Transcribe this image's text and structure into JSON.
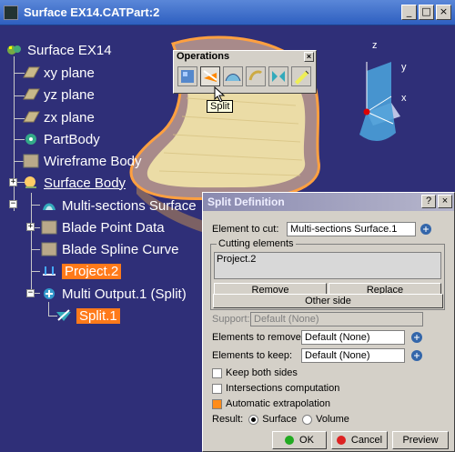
{
  "window": {
    "title": "Surface EX14.CATPart:2",
    "min": "_",
    "max": "□",
    "close": "×"
  },
  "tree": {
    "root": "Surface EX14",
    "items": [
      {
        "label": "xy plane"
      },
      {
        "label": "yz plane"
      },
      {
        "label": "zx plane"
      },
      {
        "label": "PartBody"
      },
      {
        "label": "Wireframe Body"
      },
      {
        "label": "Surface Body"
      },
      {
        "label": "Multi-sections Surface"
      },
      {
        "label": "Blade Point Data"
      },
      {
        "label": "Blade Spline Curve"
      },
      {
        "label": "Project.2"
      },
      {
        "label": "Multi Output.1 (Split)"
      },
      {
        "label": "Split.1"
      }
    ]
  },
  "operations": {
    "title": "Operations",
    "close": "×",
    "tooltip": "Split"
  },
  "compass": {
    "x": "x",
    "y": "y",
    "z": "z"
  },
  "dialog": {
    "title": "Split Definition",
    "help": "?",
    "close": "×",
    "element_to_cut_label": "Element to cut:",
    "element_to_cut_value": "Multi-sections Surface.1",
    "cutting_elements_label": "Cutting elements",
    "cutting_list": [
      "Project.2"
    ],
    "remove": "Remove",
    "replace": "Replace",
    "other_side": "Other side",
    "support_label": "Support:",
    "support_value": "Default (None)",
    "remove_label": "Elements to remove:",
    "remove_value": "Default (None)",
    "keep_label": "Elements to keep:",
    "keep_value": "Default (None)",
    "keep_both": "Keep both sides",
    "intersections": "Intersections computation",
    "auto_extrap": "Automatic extrapolation",
    "result_label": "Result:",
    "result_surface": "Surface",
    "result_volume": "Volume",
    "ok": "OK",
    "cancel": "Cancel",
    "preview": "Preview"
  },
  "colors": {
    "selection": "#ff7a1a",
    "viewport": "#2f2f78",
    "surface": "#f2e4a8"
  }
}
